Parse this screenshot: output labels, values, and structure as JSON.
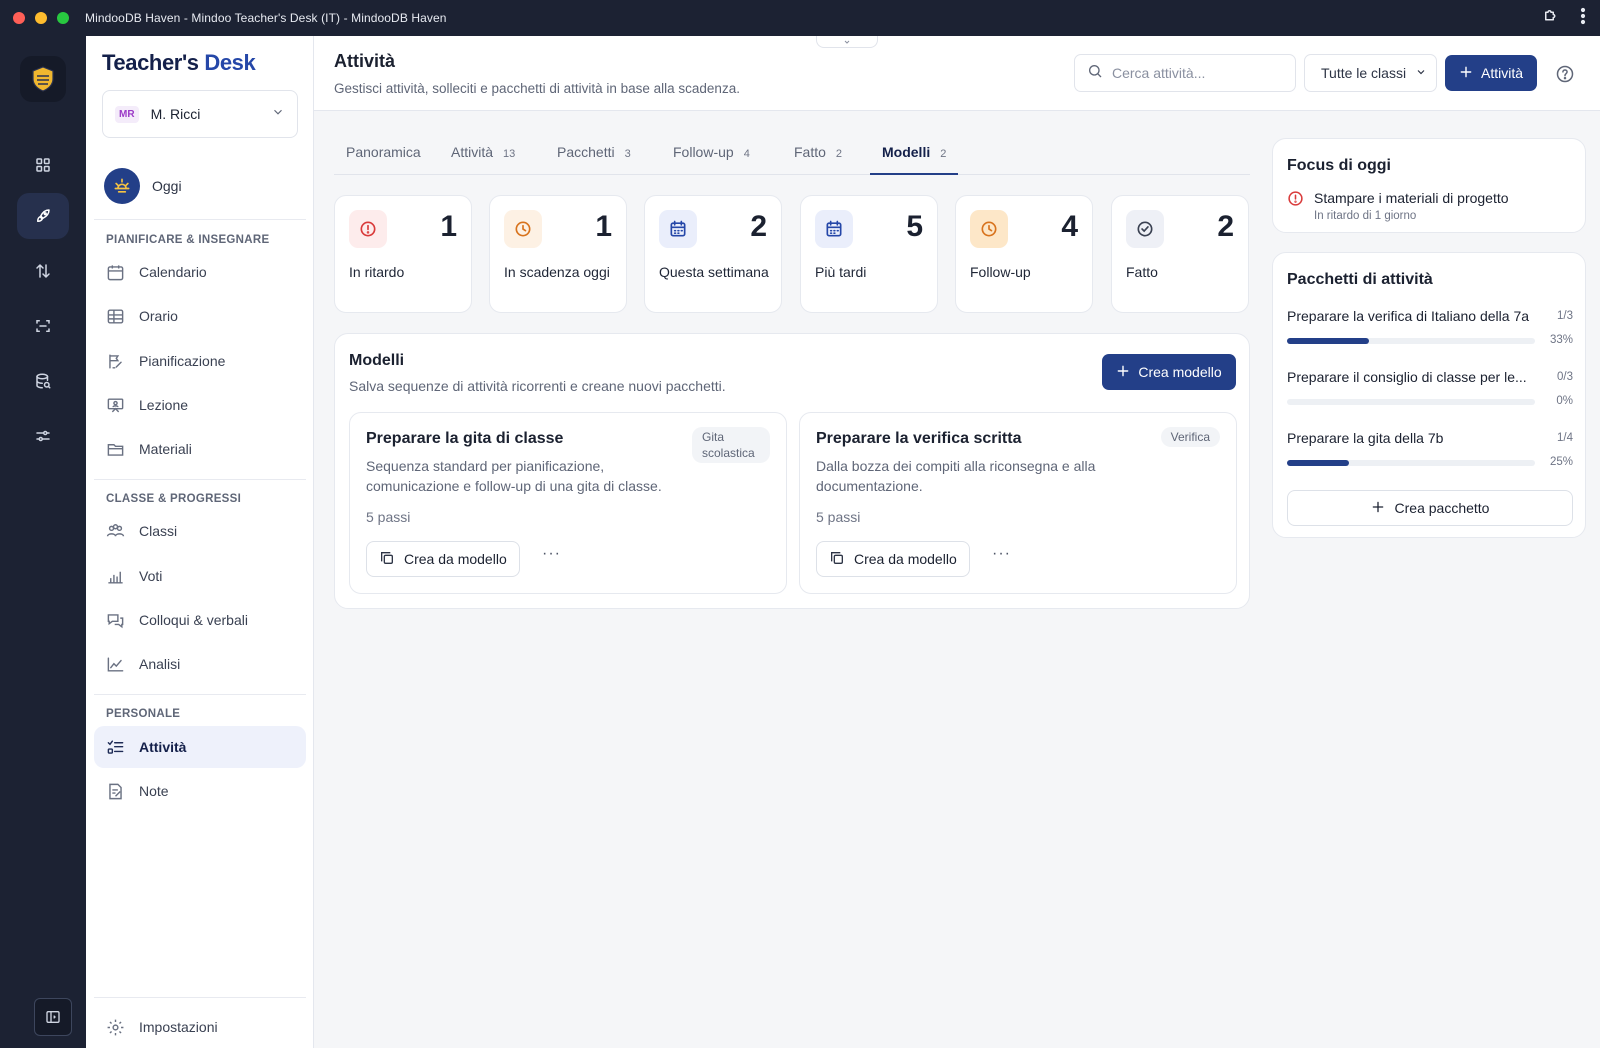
{
  "window": {
    "title": "MindooDB Haven - Mindoo Teacher's Desk (IT) - MindooDB Haven"
  },
  "sidebar": {
    "brand_a": "Teacher's",
    "brand_b": "Desk",
    "user": {
      "initials": "MR",
      "name": "M. Ricci"
    },
    "today": "Oggi",
    "sections": [
      {
        "title": "PIANIFICARE & INSEGNARE",
        "items": [
          "Calendario",
          "Orario",
          "Pianificazione",
          "Lezione",
          "Materiali"
        ]
      },
      {
        "title": "CLASSE & PROGRESSI",
        "items": [
          "Classi",
          "Voti",
          "Colloqui & verbali",
          "Analisi"
        ]
      },
      {
        "title": "PERSONALE",
        "items": [
          "Attività",
          "Note"
        ]
      }
    ],
    "active_item": "Attività",
    "settings": "Impostazioni"
  },
  "header": {
    "title": "Attività",
    "subtitle": "Gestisci attività, solleciti e pacchetti di attività in base alla scadenza.",
    "search_placeholder": "Cerca attività...",
    "class_filter": "Tutte le classi",
    "new_button": "Attività"
  },
  "tabs": [
    {
      "label": "Panoramica",
      "count": ""
    },
    {
      "label": "Attività",
      "count": "13"
    },
    {
      "label": "Pacchetti",
      "count": "3"
    },
    {
      "label": "Follow-up",
      "count": "4"
    },
    {
      "label": "Fatto",
      "count": "2"
    },
    {
      "label": "Modelli",
      "count": "2"
    }
  ],
  "active_tab": "Modelli",
  "stats": [
    {
      "value": "1",
      "label": "In ritardo",
      "icon": "alert-icon",
      "color": "#d93a3a",
      "bg": "#fdecec"
    },
    {
      "value": "1",
      "label": "In scadenza oggi",
      "icon": "clock-icon",
      "color": "#d8731d",
      "bg": "#fdf1e4"
    },
    {
      "value": "2",
      "label": "Questa settimana",
      "icon": "calendar-icon",
      "color": "#2547a8",
      "bg": "#eaeefb"
    },
    {
      "value": "5",
      "label": "Più tardi",
      "icon": "calendar-icon",
      "color": "#2547a8",
      "bg": "#eaeefb"
    },
    {
      "value": "4",
      "label": "Follow-up",
      "icon": "clock-icon",
      "color": "#d8731d",
      "bg": "#fde7c8"
    },
    {
      "value": "2",
      "label": "Fatto",
      "icon": "check-circle-icon",
      "color": "#3a4152",
      "bg": "#eef0f6"
    }
  ],
  "templates": {
    "title": "Modelli",
    "subtitle": "Salva sequenze di attività ricorrenti e creane nuovi pacchetti.",
    "create_button": "Crea modello",
    "items": [
      {
        "title": "Preparare la gita di classe",
        "tag": "Gita scolastica",
        "description": "Sequenza standard per pianificazione, comunicazione e follow-up di una gita di classe.",
        "steps": "5 passi",
        "action": "Crea da modello"
      },
      {
        "title": "Preparare la verifica scritta",
        "tag": "Verifica",
        "description": "Dalla bozza dei compiti alla riconsegna e alla documentazione.",
        "steps": "5 passi",
        "action": "Crea da modello"
      }
    ]
  },
  "focus": {
    "title": "Focus di oggi",
    "item": "Stampare i materiali di progetto",
    "item_sub": "In ritardo di 1 giorno"
  },
  "bundles": {
    "title": "Pacchetti di attività",
    "items": [
      {
        "name": "Preparare la verifica di Italiano della 7a",
        "fraction": "1/3",
        "percent": "33%",
        "progress": 0.33
      },
      {
        "name": "Preparare il consiglio di classe per le...",
        "fraction": "0/3",
        "percent": "0%",
        "progress": 0
      },
      {
        "name": "Preparare la gita della 7b",
        "fraction": "1/4",
        "percent": "25%",
        "progress": 0.25
      }
    ],
    "create_button": "Crea pacchetto"
  },
  "colors": {
    "accent": "#233f88",
    "rail": "#1c2233"
  }
}
